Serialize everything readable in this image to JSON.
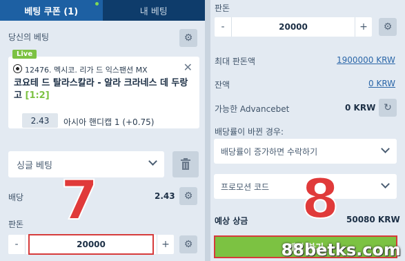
{
  "tabs": [
    {
      "label": "베팅 쿠폰 (1)"
    },
    {
      "label": "내 베팅"
    }
  ],
  "my_bets": {
    "title": "당신의 베팅"
  },
  "bet": {
    "live_label": "Live",
    "event": "12476. 멕시코. 리가 드 익스팬션 MX",
    "match": "코요테 드 탈라스칼라 - 알라 크라네스 데 두랑고",
    "score": "[1:2]",
    "odd": "2.43",
    "market": "아시아 핸디캡 1 (+0.75)"
  },
  "bet_type": {
    "selected": "싱글 베팅"
  },
  "odds_row": {
    "label": "배당",
    "value": "2.43"
  },
  "stake_left": {
    "label": "판돈",
    "minus": "-",
    "value": "20000",
    "plus": "+"
  },
  "annotations": {
    "seven": "7",
    "eight": "8"
  },
  "right": {
    "stake": {
      "label": "판돈",
      "minus": "-",
      "value": "20000",
      "plus": "+"
    },
    "max_stake": {
      "label": "최대 판돈액",
      "value": "1900000 KRW"
    },
    "balance": {
      "label": "잔액",
      "value": "0 KRW"
    },
    "advancebet": {
      "label": "가능한 Advancebet",
      "value": "0 KRW"
    },
    "odds_change": {
      "label": "배당률이 바뀐 경우:",
      "selected": "배당률이 증가하면 수락하기"
    },
    "promo": {
      "placeholder": "프로모션 코드"
    },
    "expected_win": {
      "label": "예상 상금",
      "value": "50080 KRW"
    },
    "place_bet": "베팅 하기"
  },
  "watermark": "88betks.com",
  "colors": {
    "accent": "#1d60a3",
    "green": "#7cc242",
    "highlight": "#d63a3a"
  }
}
